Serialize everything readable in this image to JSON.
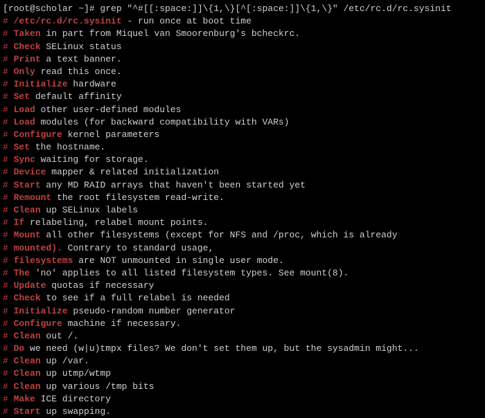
{
  "prompt": "[root@scholar ~]# grep \"^#[[:space:]]\\{1,\\}[^[:space:]]\\{1,\\}\" /etc/rc.d/rc.sysinit",
  "lines": [
    {
      "filepath": "/etc/rc.d/rc.sysinit",
      "rest": " - run once at boot time"
    },
    {
      "keyword": "Taken",
      "rest": " in part from Miquel van Smoorenburg's bcheckrc."
    },
    {
      "keyword": "Check",
      "rest": " SELinux status"
    },
    {
      "keyword": "Print",
      "rest": " a text banner."
    },
    {
      "keyword": "Only",
      "rest": " read this once."
    },
    {
      "keyword": "Initialize",
      "rest": " hardware"
    },
    {
      "keyword": "Set",
      "rest": " default affinity"
    },
    {
      "keyword": "Load",
      "rest": " other user-defined modules"
    },
    {
      "keyword": "Load",
      "rest": " modules (for backward compatibility with VARs)"
    },
    {
      "keyword": "Configure",
      "rest": " kernel parameters"
    },
    {
      "keyword": "Set",
      "rest": " the hostname."
    },
    {
      "keyword": "Sync",
      "rest": " waiting for storage."
    },
    {
      "keyword": "Device",
      "rest": " mapper & related initialization"
    },
    {
      "keyword": "Start",
      "rest": " any MD RAID arrays that haven't been started yet"
    },
    {
      "keyword": "Remount",
      "rest": " the root filesystem read-write."
    },
    {
      "keyword": "Clean",
      "rest": " up SELinux labels"
    },
    {
      "keyword": "If",
      "rest": " relabeling, relabel mount points."
    },
    {
      "keyword": "Mount",
      "rest": " all other filesystems (except for NFS and /proc, which is already"
    },
    {
      "keyword": "mounted).",
      "rest": " Contrary to standard usage,"
    },
    {
      "keyword": "filesystems",
      "rest": " are NOT unmounted in single user mode."
    },
    {
      "keyword": "The",
      "rest": " 'no' applies to all listed filesystem types. See mount(8)."
    },
    {
      "keyword": "Update",
      "rest": " quotas if necessary"
    },
    {
      "keyword": "Check",
      "rest": " to see if a full relabel is needed"
    },
    {
      "keyword": "Initialize",
      "rest": " pseudo-random number generator"
    },
    {
      "keyword": "Configure",
      "rest": " machine if necessary."
    },
    {
      "keyword": "Clean",
      "rest": " out /."
    },
    {
      "keyword": "Do",
      "rest": " we need (w|u)tmpx files? We don't set them up, but the sysadmin might..."
    },
    {
      "keyword": "Clean",
      "rest": " up /var."
    },
    {
      "keyword": "Clean",
      "rest": " up utmp/wtmp"
    },
    {
      "keyword": "Clean",
      "rest": " up various /tmp bits"
    },
    {
      "keyword": "Make",
      "rest": " ICE directory"
    },
    {
      "keyword": "Start",
      "rest": " up swapping."
    }
  ],
  "hash": "# "
}
